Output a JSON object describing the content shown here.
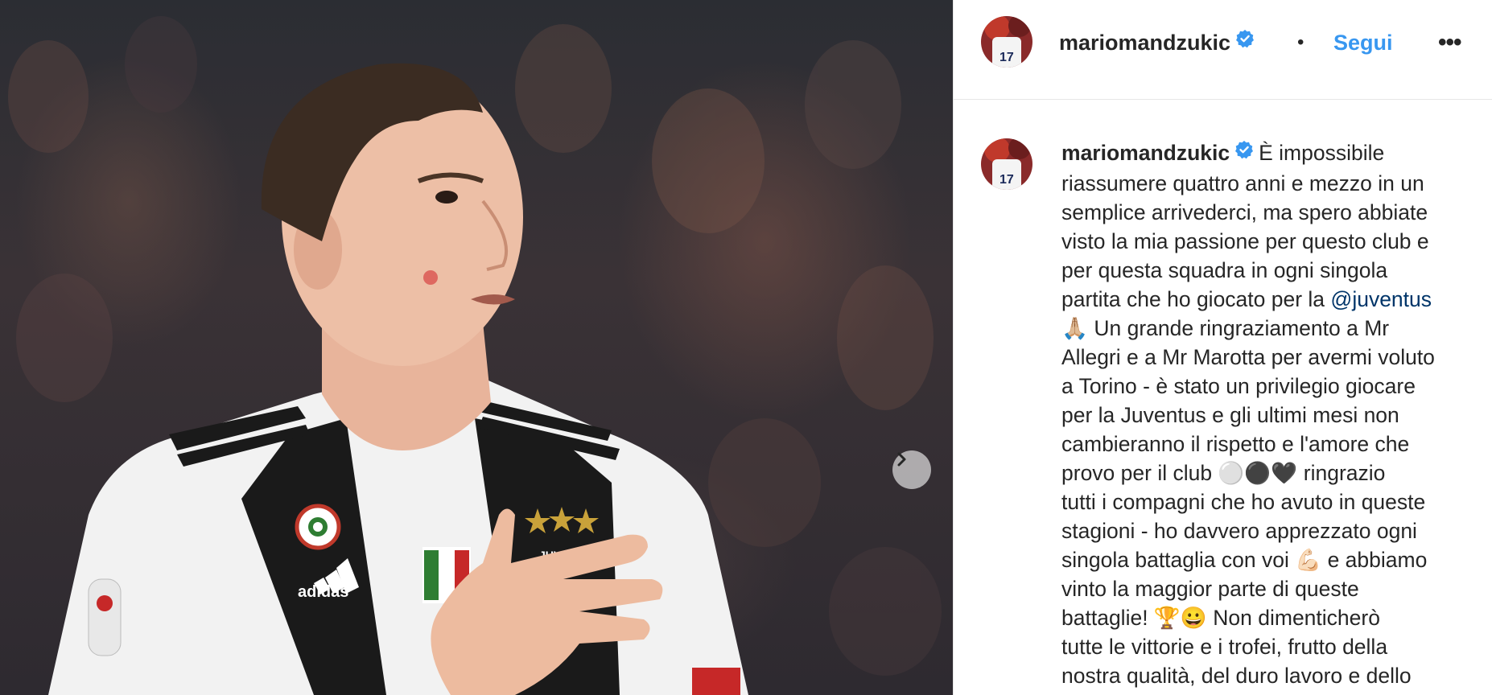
{
  "post": {
    "username": "mariomandzukic",
    "dot": "•",
    "follow_label": "Segui",
    "more_label": "•••"
  },
  "caption": {
    "username": "mariomandzukic",
    "part1": "È impossibile\nriassumere quattro anni e mezzo in un\nsemplice arrivederci, ma spero abbiate\nvisto la mia passione per questo club e\nper questa squadra in ogni singola\npartita che ho giocato per la ",
    "mention": "@juventus",
    "part2": "\n🙏🏼 Un grande ringraziamento a Mr\nAllegri e a Mr Marotta per avermi voluto\na Torino - è stato un privilegio giocare\nper la Juventus e gli ultimi mesi non\ncambieranno il rispetto e l'amore che\nprovo per il club ⚪⚫🖤 ringrazio\ntutti i compagni che ho avuto in queste\nstagioni - ho davvero apprezzato ogni\nsingola battaglia con voi 💪🏻 e abbiamo\nvinto la maggior parte di queste\nbattaglie! 🏆😀 Non dimenticherò\ntutte le vittorie e i trofei, frutto della\nnostra qualità, del duro lavoro e dello"
  },
  "photo": {
    "jersey_text": "JUVENTUS",
    "brand_text": "adidas",
    "shirt_number": "17"
  },
  "colors": {
    "link": "#3897f0",
    "mention": "#003569",
    "verified": "#3897f0",
    "text": "#262626"
  },
  "icons": {
    "verified": "verified-badge-icon",
    "next": "chevron-right-icon"
  }
}
